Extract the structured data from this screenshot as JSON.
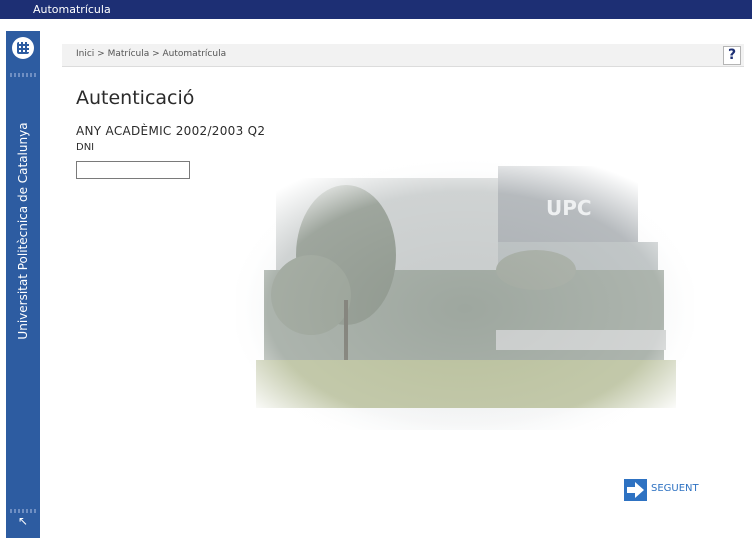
{
  "window": {
    "title": "Automatrícula"
  },
  "sidebar": {
    "org_name": "Universitat Politècnica de Catalunya"
  },
  "breadcrumb": {
    "path": "Inici > Matrícula > Automatrícula"
  },
  "help": {
    "label": "?"
  },
  "main": {
    "title": "Autenticació",
    "academic_year": "ANY ACADÈMIC 2002/2003 Q2",
    "dni_label": "DNI",
    "dni_value": ""
  },
  "photo": {
    "sign_text": "UPC"
  },
  "actions": {
    "next_label": "SEGUENT"
  },
  "icons": {
    "logo": "upc-logo-icon",
    "back": "arrow-up-left-icon",
    "next": "arrow-right-icon"
  },
  "colors": {
    "titlebar": "#1d2f74",
    "sidebar": "#2d5ca1",
    "accent": "#2e72c2"
  }
}
